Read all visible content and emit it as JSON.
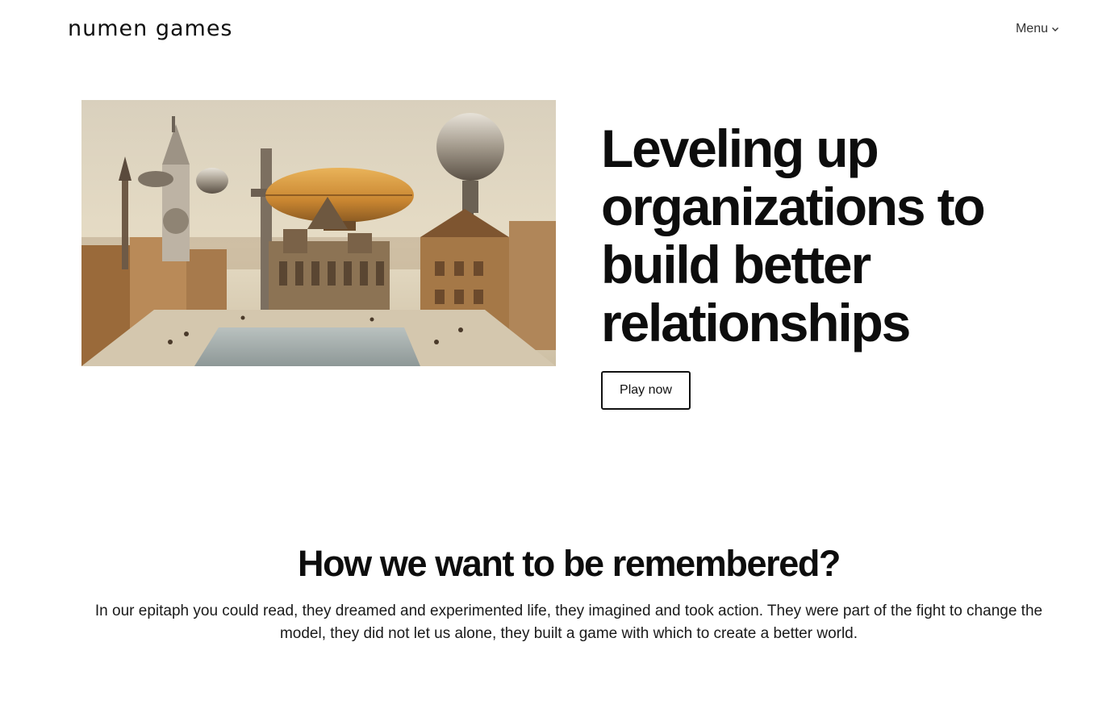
{
  "header": {
    "logo_text": "numen games",
    "menu_label": "Menu"
  },
  "hero": {
    "image_alt": "Steampunk city with airships",
    "title": "Leveling up organizations to build better relationships",
    "cta_label": "Play now"
  },
  "remember": {
    "title": "How we want to be remembered?",
    "body": "In our epitaph you could read, they dreamed and experimented life, they imagined and took action. They were part of the fight to change the model, they did not let us alone, they built a game with which to create a better world."
  },
  "icons": {
    "menu_chevron": "chevron-down-icon"
  },
  "colors": {
    "background": "#ffffff",
    "text": "#111111",
    "button_border": "#111111"
  }
}
